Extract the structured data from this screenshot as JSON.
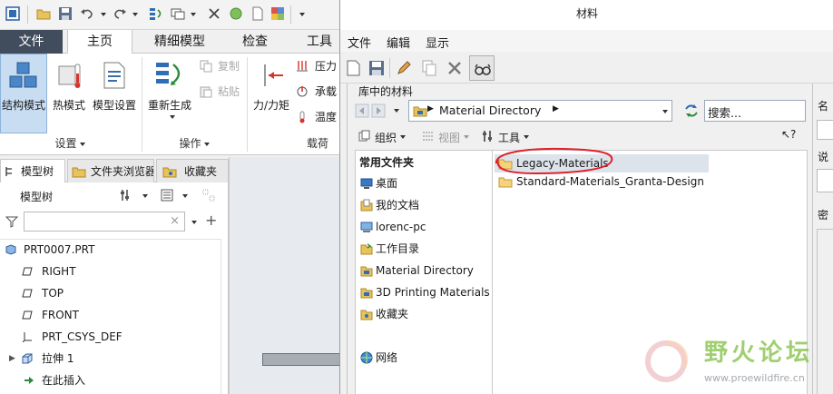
{
  "left_app": {
    "ribbon_tabs": [
      "文件",
      "主页",
      "精细模型",
      "检查",
      "工具"
    ],
    "ribbon": {
      "structure_mode": "结构模式",
      "thermal_mode": "热模式",
      "model_setup": "模型设置",
      "regenerate": "重新生成",
      "copy": "复制",
      "paste": "粘贴",
      "force_moment": "力/力矩",
      "pressure": "压力",
      "bearing": "承载",
      "temperature": "温度",
      "group_setup": "设置",
      "group_operation": "操作",
      "group_loads": "载荷"
    },
    "panel_tabs": [
      "模型树",
      "文件夹浏览器",
      "收藏夹"
    ],
    "tree": {
      "heading": "模型树",
      "items": [
        {
          "label": "PRT0007.PRT",
          "icon": "part-icon"
        },
        {
          "label": "RIGHT",
          "icon": "datum-plane-icon"
        },
        {
          "label": "TOP",
          "icon": "datum-plane-icon"
        },
        {
          "label": "FRONT",
          "icon": "datum-plane-icon"
        },
        {
          "label": "PRT_CSYS_DEF",
          "icon": "csys-icon"
        },
        {
          "label": "拉伸 1",
          "icon": "extrude-icon"
        },
        {
          "label": "在此插入",
          "icon": "insert-here-icon"
        }
      ]
    }
  },
  "dialog": {
    "title": "材料",
    "menu": [
      "文件",
      "编辑",
      "显示"
    ],
    "library_title": "库中的材料",
    "address": "Material Directory",
    "search_placeholder": "搜索...",
    "sub_toolbar": {
      "organize": "组织",
      "view": "视图",
      "tools": "工具"
    },
    "nav": {
      "heading": "常用文件夹",
      "items": [
        {
          "label": "桌面",
          "icon": "desktop-icon"
        },
        {
          "label": "我的文档",
          "icon": "documents-icon"
        },
        {
          "label": "lorenc-pc",
          "icon": "computer-icon"
        },
        {
          "label": "工作目录",
          "icon": "working-dir-icon"
        },
        {
          "label": "Material Directory",
          "icon": "folder-icon"
        },
        {
          "label": "3D Printing Materials",
          "icon": "folder-icon"
        },
        {
          "label": "收藏夹",
          "icon": "favorites-icon"
        },
        {
          "label": "网络",
          "icon": "network-icon"
        }
      ]
    },
    "files": [
      {
        "label": "Legacy-Materials",
        "selected": true
      },
      {
        "label": "Standard-Materials_Granta-Design",
        "selected": false
      }
    ],
    "props": [
      "名",
      "说",
      "密"
    ]
  },
  "watermark": {
    "text": "野火论坛",
    "url": "www.proewildfire.cn"
  },
  "colors": {
    "file_tab": "#414c5c",
    "accent_blue": "#2f6db5",
    "folder_yellow": "#e8c25a",
    "annotation_red": "#e0202a",
    "watermark_green": "#7fbf3f"
  }
}
